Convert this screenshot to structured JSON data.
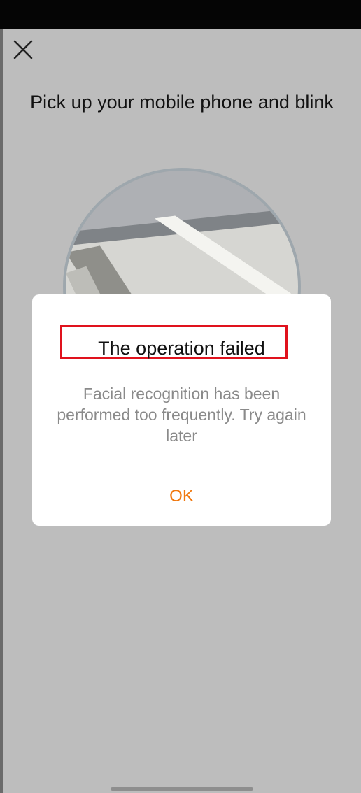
{
  "header": {
    "close_icon": "close-icon",
    "title": "Pick up your mobile phone and blink"
  },
  "camera": {
    "icon": "camera-preview"
  },
  "dialog": {
    "title": "The operation failed",
    "message": "Facial recognition has been performed too frequently. Try again later",
    "ok_label": "OK",
    "highlight_color": "#e0121d",
    "accent_color": "#f0780f"
  }
}
